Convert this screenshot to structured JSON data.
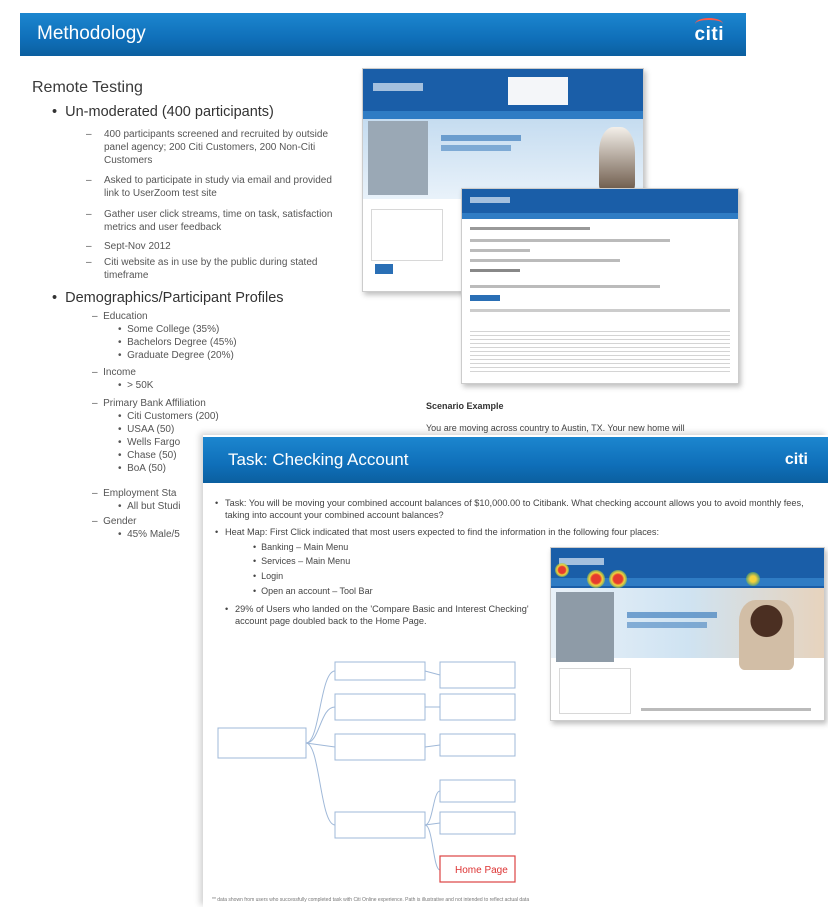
{
  "slide1": {
    "title": "Methodology",
    "logo": "citi",
    "section_heading": "Remote Testing",
    "bullet1": "Un-moderated (400 participants)",
    "sub1": [
      "400 participants screened and recruited by outside panel agency; 200 Citi Customers, 200 Non-Citi Customers",
      "Asked to participate in study via email and provided link to UserZoom test site",
      "Gather user click streams, time on task, satisfaction metrics and user feedback",
      "Sept-Nov 2012",
      "Citi website as in use by the public during stated timeframe"
    ],
    "bullet2": "Demographics/Participant Profiles",
    "demo": {
      "education_label": "Education",
      "education": [
        "Some College (35%)",
        "Bachelors Degree (45%)",
        "Graduate Degree (20%)"
      ],
      "income_label": "Income",
      "income": [
        "> 50K"
      ],
      "bank_label": "Primary Bank Affiliation",
      "bank": [
        "Citi Customers (200)",
        "USAA (50)",
        "Wells Fargo",
        "Chase (50)",
        "BoA (50)"
      ],
      "employment_label": "Employment Sta",
      "employment": [
        "All but Studi"
      ],
      "gender_label": "Gender",
      "gender": [
        "45% Male/5"
      ]
    },
    "scenario_label": "Scenario Example",
    "scenario_text": "You are moving across country to Austin, TX. Your new home will"
  },
  "slide2": {
    "title": "Task: Checking Account",
    "logo": "citi",
    "task_text": "Task: You will be moving your combined account balances of $10,000.00 to Citibank. What checking account allows you to avoid monthly fees, taking into account your combined account balances?",
    "heatmap_text": "Heat Map: First Click indicated that most users expected to find the information in the following four places:",
    "places": [
      "Banking – Main Menu",
      "Services – Main Menu",
      "Login",
      "Open an account – Tool Bar"
    ],
    "stat_text": "29% of Users who landed on the 'Compare Basic and Interest Checking' account page doubled back to the Home Page.",
    "home_page_label": "Home Page",
    "footnote": "** data shown from users who successfully completed task with Citi Online experience. Path is illustrative and not intended to reflect actual data"
  },
  "colors": {
    "banner": "#0f6fb9",
    "logo_arc": "#ff5a4a",
    "heat_red": "#e63b2e",
    "heat_green": "#7bc043"
  }
}
